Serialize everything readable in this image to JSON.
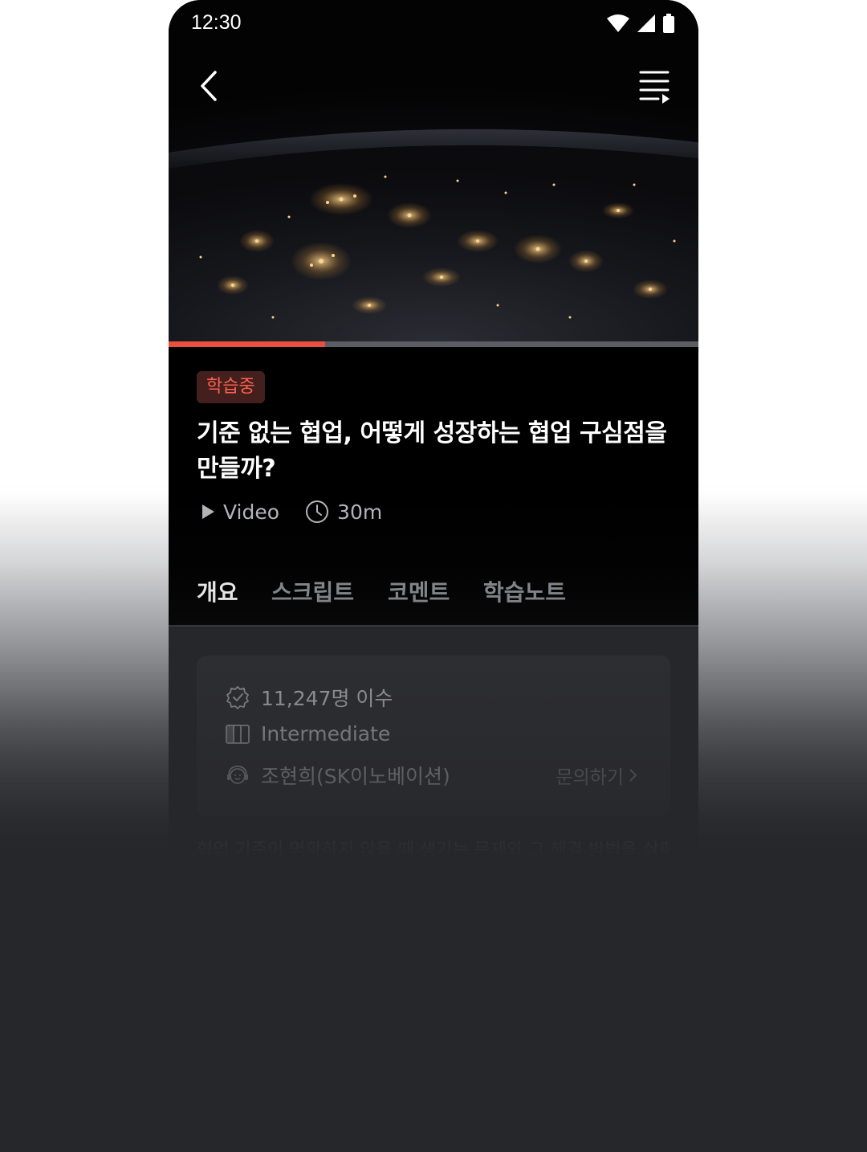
{
  "status_bar": {
    "time": "12:30"
  },
  "progress": {
    "fraction": 0.295,
    "color": "#e9503f",
    "track_color": "#5b5d62"
  },
  "badge": {
    "label": "학습중"
  },
  "course": {
    "title": "기준 없는 협업, 어떻게 성장하는 협업 구심점을 만들까?",
    "type": "Video",
    "duration": "30m"
  },
  "tabs": [
    {
      "label": "개요",
      "active": true
    },
    {
      "label": "스크립트",
      "active": false
    },
    {
      "label": "코멘트",
      "active": false
    },
    {
      "label": "학습노트",
      "active": false
    }
  ],
  "info": {
    "completions": "11,247명 이수",
    "level": "Intermediate",
    "instructor": "조현희(SK이노베이션)",
    "inquiry_label": "문의하기"
  },
  "description_preview": "협업 기준이 명확하지 않을 때 생기는 문제와 그 해결 방법을 살펴봅니다.",
  "colors": {
    "accent": "#e9503f",
    "background": "#26272b",
    "phone_bg": "#000000"
  },
  "icons": [
    "back-arrow-icon",
    "playlist-icon",
    "play-icon",
    "clock-icon",
    "verified-badge-icon",
    "level-bars-icon",
    "instructor-headset-icon",
    "chevron-right-icon"
  ]
}
